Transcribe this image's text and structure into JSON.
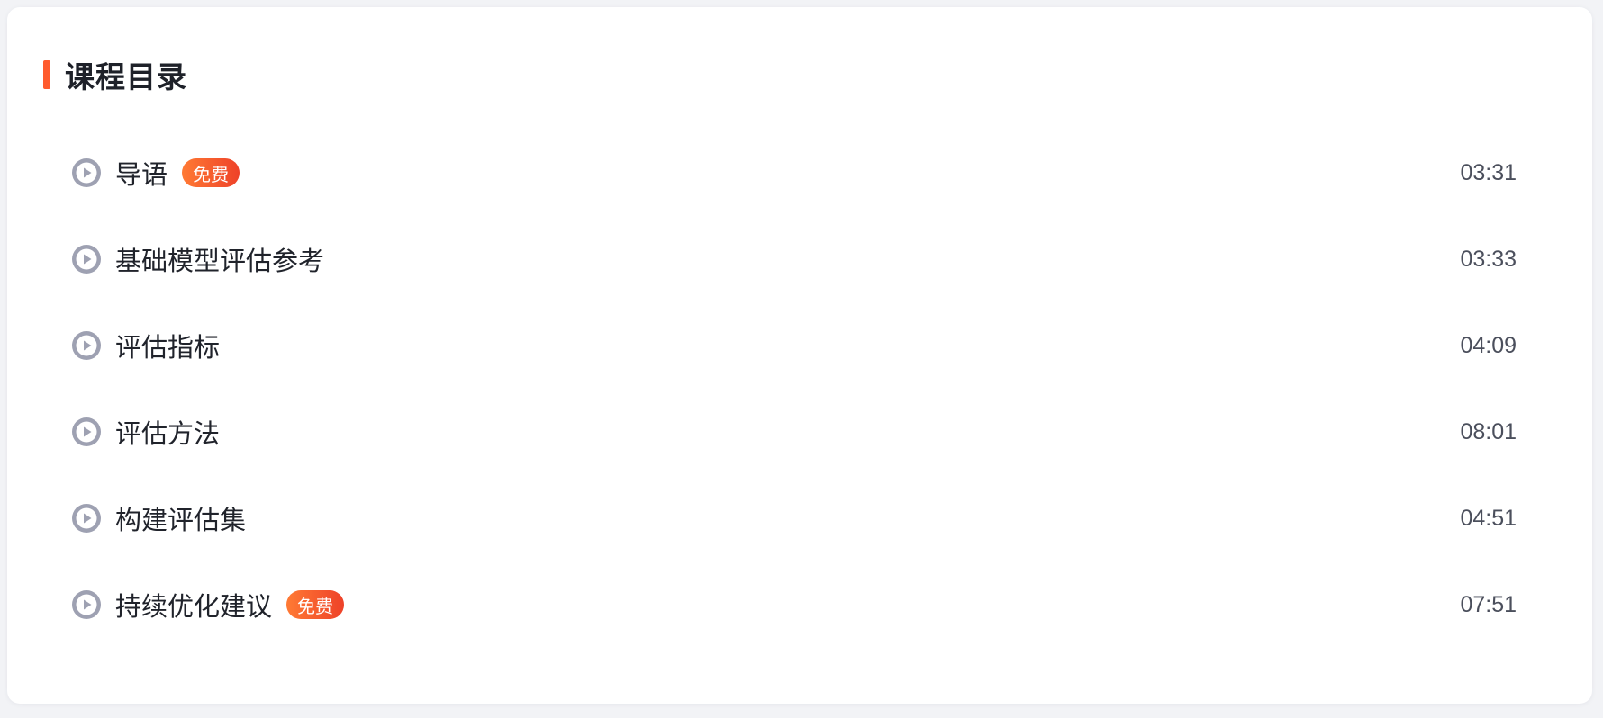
{
  "catalog": {
    "title": "课程目录",
    "accent_color": "#ff5b2e",
    "badge_color": "#ee4229",
    "play_icon": "play-circle-icon",
    "lessons": [
      {
        "title": "导语",
        "badge": "免费",
        "duration": "03:31"
      },
      {
        "title": "基础模型评估参考",
        "badge": "",
        "duration": "03:33"
      },
      {
        "title": "评估指标",
        "badge": "",
        "duration": "04:09"
      },
      {
        "title": "评估方法",
        "badge": "",
        "duration": "08:01"
      },
      {
        "title": "构建评估集",
        "badge": "",
        "duration": "04:51"
      },
      {
        "title": "持续优化建议",
        "badge": "免费",
        "duration": "07:51"
      }
    ]
  }
}
